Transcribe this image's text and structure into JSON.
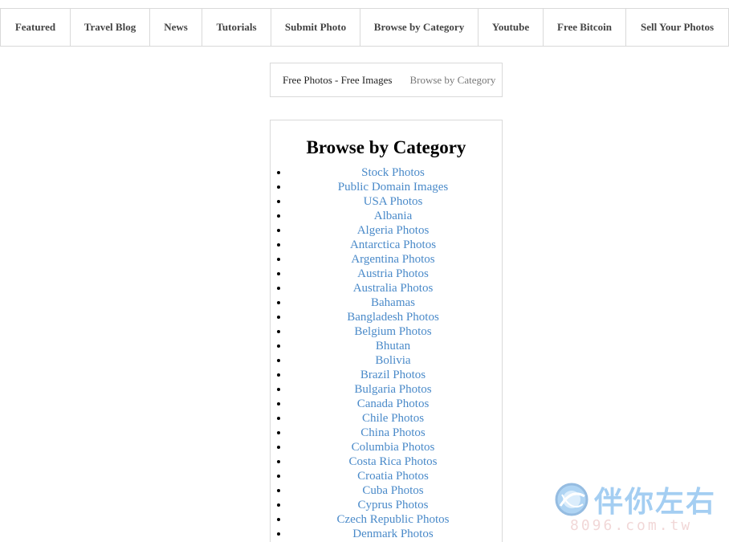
{
  "nav": {
    "items": [
      {
        "label": "Featured"
      },
      {
        "label": "Travel Blog"
      },
      {
        "label": "News"
      },
      {
        "label": "Tutorials"
      },
      {
        "label": "Submit Photo"
      },
      {
        "label": "Browse by Category"
      },
      {
        "label": "Youtube"
      },
      {
        "label": "Free Bitcoin"
      },
      {
        "label": "Sell Your Photos"
      }
    ]
  },
  "breadcrumb": {
    "home": "Free Photos - Free Images",
    "current": "Browse by Category"
  },
  "category": {
    "title": "Browse by Category",
    "items": [
      "Stock Photos",
      "Public Domain Images",
      "USA Photos",
      "Albania",
      "Algeria Photos",
      "Antarctica Photos",
      "Argentina Photos",
      "Austria Photos",
      "Australia Photos",
      "Bahamas",
      "Bangladesh Photos",
      "Belgium Photos",
      "Bhutan",
      "Bolivia",
      "Brazil Photos",
      "Bulgaria Photos",
      "Canada Photos",
      "Chile Photos",
      "China Photos",
      "Columbia Photos",
      "Costa Rica Photos",
      "Croatia Photos",
      "Cuba Photos",
      "Cyprus Photos",
      "Czech Republic Photos",
      "Denmark Photos"
    ]
  },
  "watermark": {
    "text": "伴你左右",
    "url": "8096.com.tw",
    "icon": "globe-logo-icon"
  },
  "colors": {
    "link": "#4a8ac9",
    "border": "#d9d9d9",
    "nav_text": "#444444"
  }
}
